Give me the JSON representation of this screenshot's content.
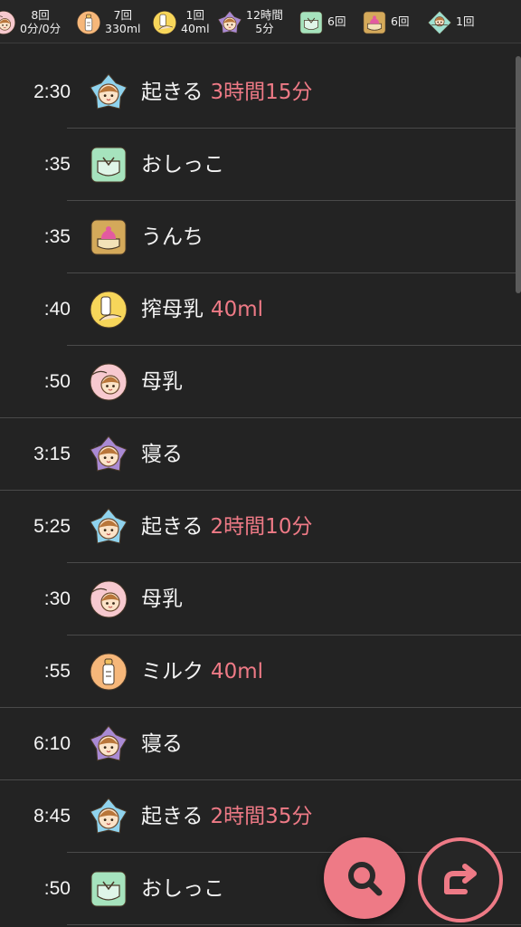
{
  "summary": [
    {
      "icon": "breastfeed-icon",
      "lines": [
        "8回",
        "0分/0分"
      ]
    },
    {
      "icon": "milk-bottle-icon",
      "lines": [
        "7回",
        "330ml"
      ]
    },
    {
      "icon": "pumped-milk-icon",
      "lines": [
        "1回",
        "40ml"
      ]
    },
    {
      "icon": "sleep-icon",
      "lines": [
        "12時間",
        "5分"
      ]
    },
    {
      "icon": "pee-icon",
      "lines": [
        "6回"
      ]
    },
    {
      "icon": "poop-icon",
      "lines": [
        "6回"
      ]
    },
    {
      "icon": "bath-icon",
      "lines": [
        "1回"
      ]
    }
  ],
  "entries": [
    {
      "time": "2:30",
      "icon": "wake-icon",
      "label": "起きる",
      "extra": "3時間15分",
      "divider": "inset"
    },
    {
      "time": ":35",
      "icon": "pee-icon",
      "label": "おしっこ",
      "extra": "",
      "divider": "inset"
    },
    {
      "time": ":35",
      "icon": "poop-icon",
      "label": "うんち",
      "extra": "",
      "divider": "inset"
    },
    {
      "time": ":40",
      "icon": "pumped-milk-icon",
      "label": "搾母乳",
      "extra": "40ml",
      "divider": "inset"
    },
    {
      "time": ":50",
      "icon": "breastfeed-icon",
      "label": "母乳",
      "extra": "",
      "divider": "full"
    },
    {
      "time": "3:15",
      "icon": "sleep-icon",
      "label": "寝る",
      "extra": "",
      "divider": "full"
    },
    {
      "time": "5:25",
      "icon": "wake-icon",
      "label": "起きる",
      "extra": "2時間10分",
      "divider": "inset"
    },
    {
      "time": ":30",
      "icon": "breastfeed-icon",
      "label": "母乳",
      "extra": "",
      "divider": "inset"
    },
    {
      "time": ":55",
      "icon": "milk-bottle-icon",
      "label": "ミルク",
      "extra": "40ml",
      "divider": "full"
    },
    {
      "time": "6:10",
      "icon": "sleep-icon",
      "label": "寝る",
      "extra": "",
      "divider": "full"
    },
    {
      "time": "8:45",
      "icon": "wake-icon",
      "label": "起きる",
      "extra": "2時間35分",
      "divider": "inset"
    },
    {
      "time": ":50",
      "icon": "pee-icon",
      "label": "おしっこ",
      "extra": "",
      "divider": "inset"
    }
  ],
  "fab": {
    "search_icon": "search-icon",
    "share_icon": "share-arrow-icon"
  },
  "colors": {
    "accent": "#ee7a86",
    "background": "#232323"
  }
}
